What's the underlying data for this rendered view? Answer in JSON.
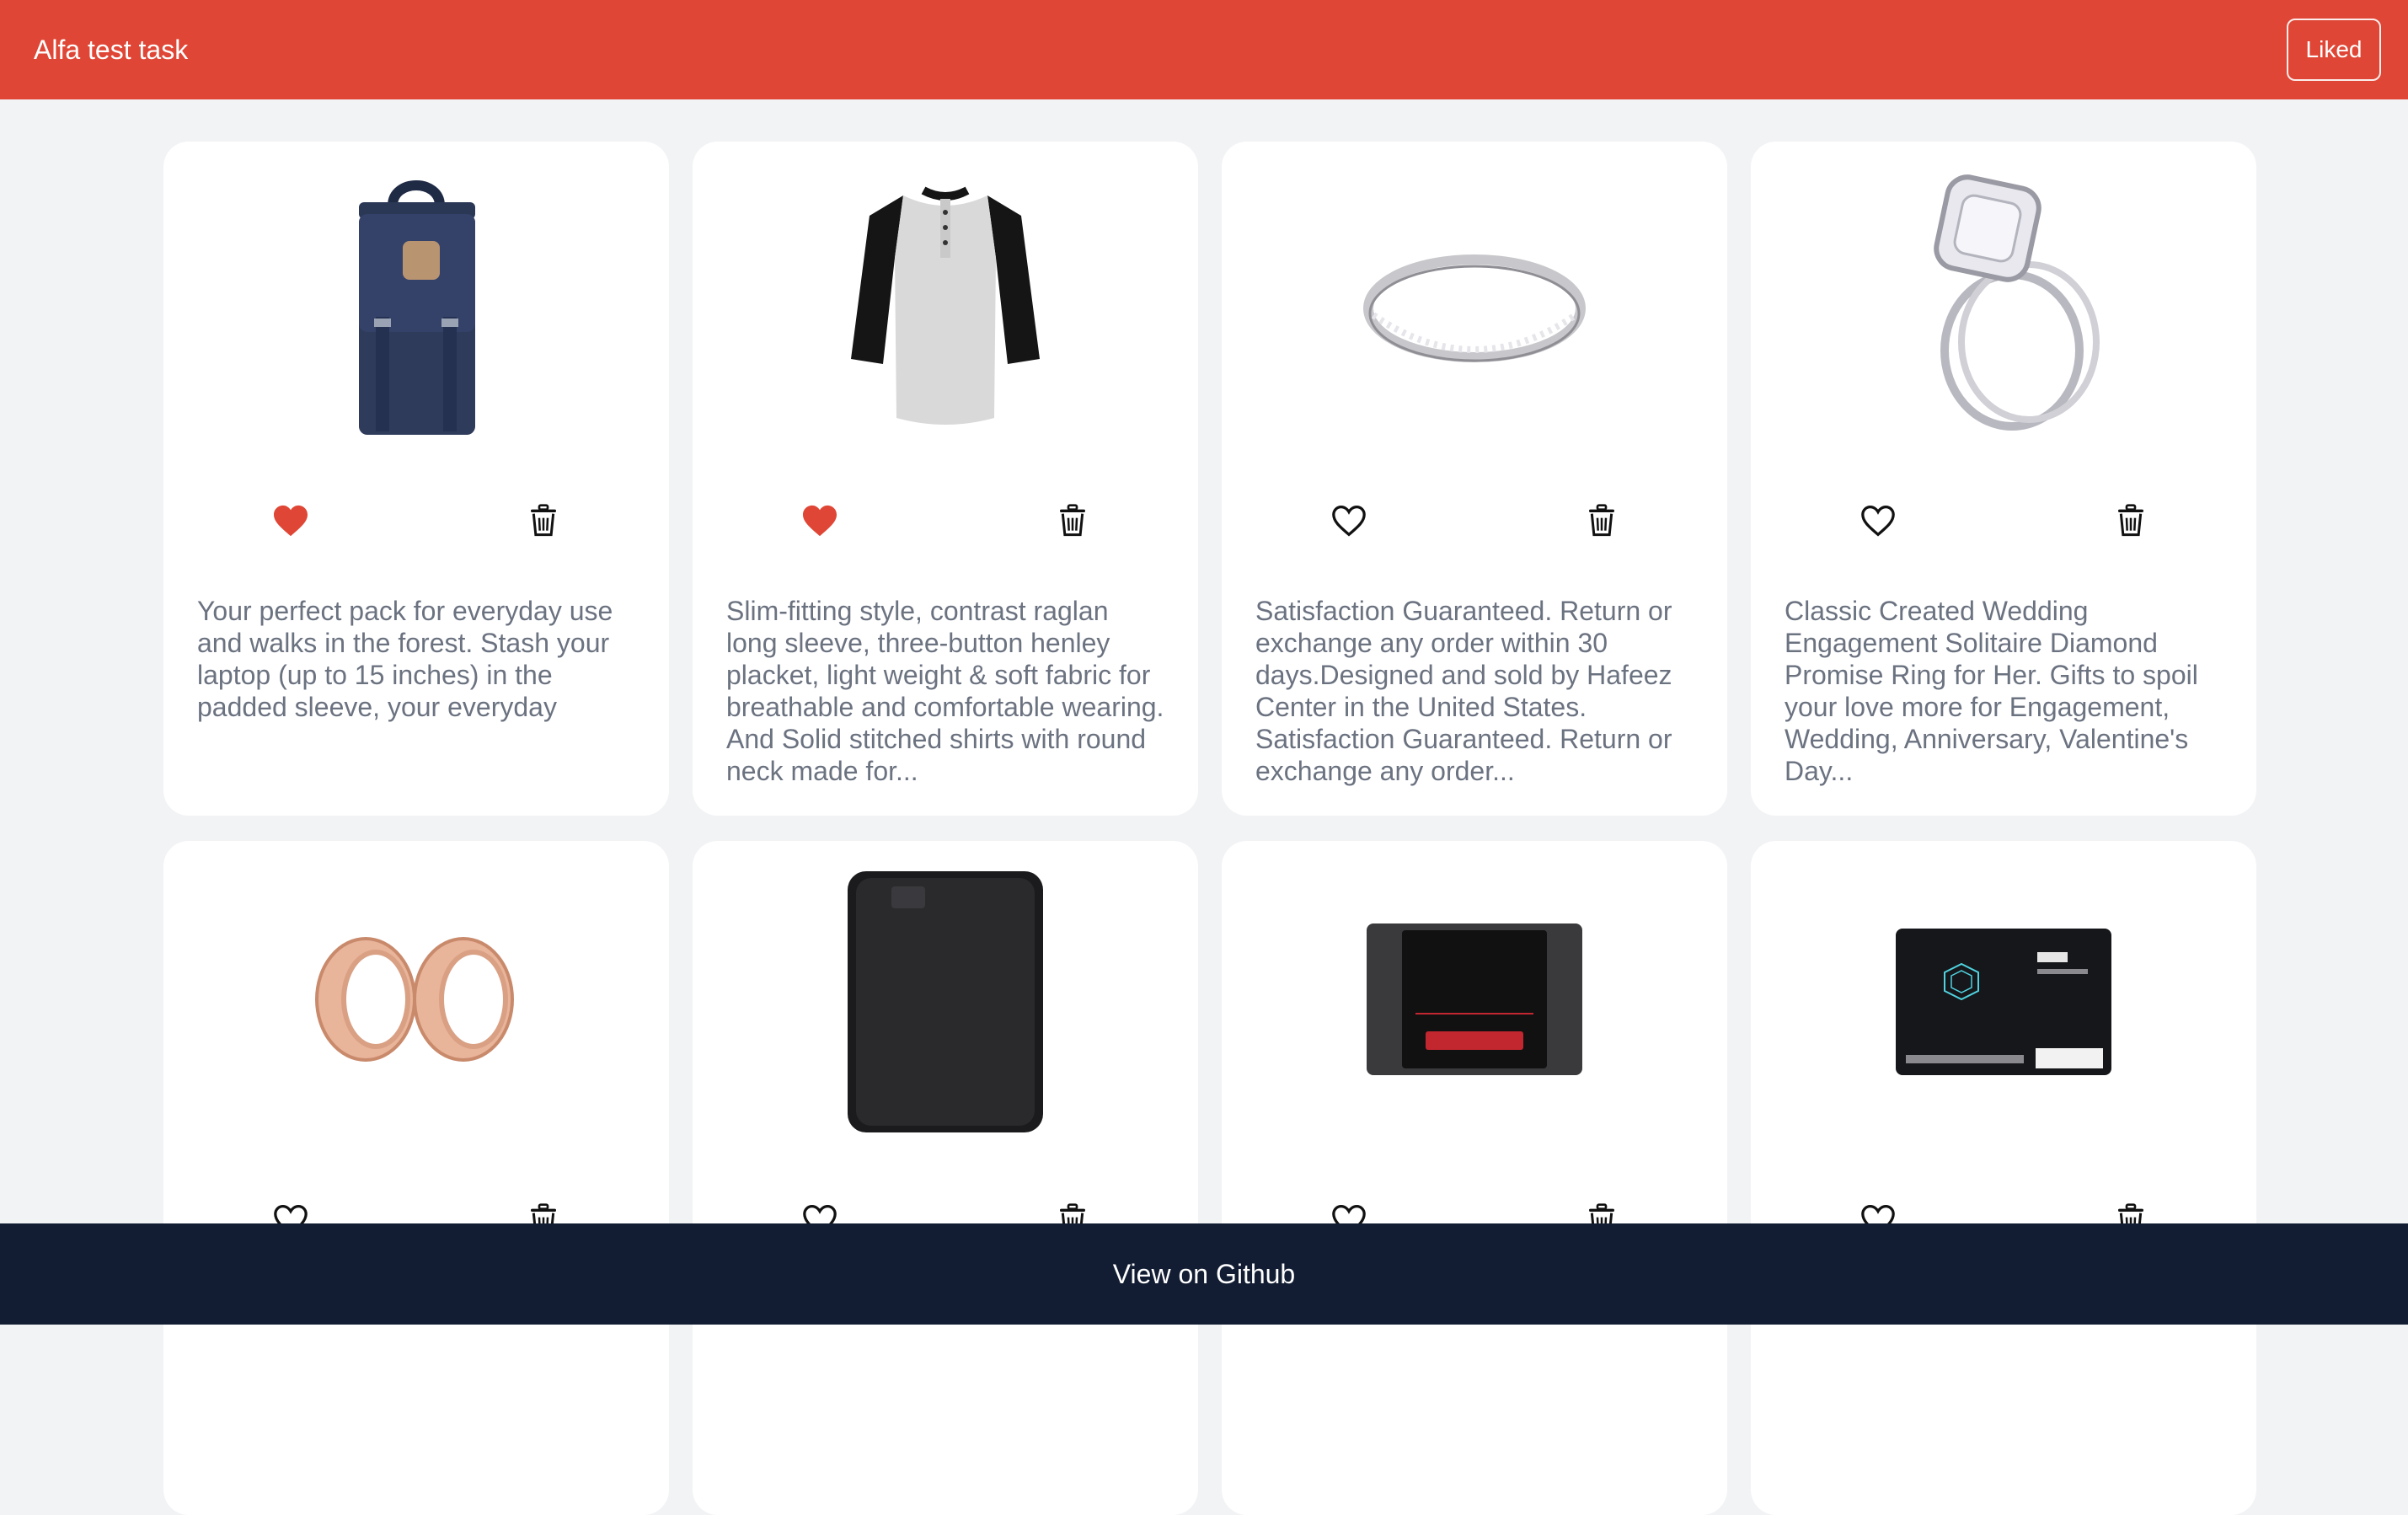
{
  "header": {
    "title": "Alfa test task",
    "liked_label": "Liked"
  },
  "footer": {
    "link_label": "View on Github"
  },
  "colors": {
    "header_bg": "#df4635",
    "footer_bg": "#121d33",
    "liked_heart": "#df4635",
    "page_bg": "#f2f3f5"
  },
  "products": [
    {
      "image": "navy-backpack",
      "liked": true,
      "description": "Your perfect pack for everyday use and walks in the forest. Stash your laptop (up to 15 inches) in the padded sleeve, your everyday"
    },
    {
      "image": "raglan-henley-shirt",
      "liked": true,
      "description": "Slim-fitting style, contrast raglan long sleeve, three-button henley placket, light weight & soft fabric for breathable and comfortable wearing. And Solid stitched shirts with round neck made for..."
    },
    {
      "image": "silver-band-ring",
      "liked": false,
      "description": "Satisfaction Guaranteed. Return or exchange any order within 30 days.Designed and sold by Hafeez Center in the United States. Satisfaction Guaranteed. Return or exchange any order..."
    },
    {
      "image": "diamond-wedding-ring",
      "liked": false,
      "description": "Classic Created Wedding Engagement Solitaire Diamond Promise Ring for Her. Gifts to spoil your love more for Engagement, Wedding, Anniversary, Valentine's Day..."
    },
    {
      "image": "rose-gold-plugs",
      "liked": false,
      "description": ""
    },
    {
      "image": "black-external-drive",
      "liked": false,
      "description": ""
    },
    {
      "image": "sandisk-ssd",
      "liked": false,
      "description": ""
    },
    {
      "image": "silicon-power-ssd",
      "liked": false,
      "description": ""
    }
  ]
}
